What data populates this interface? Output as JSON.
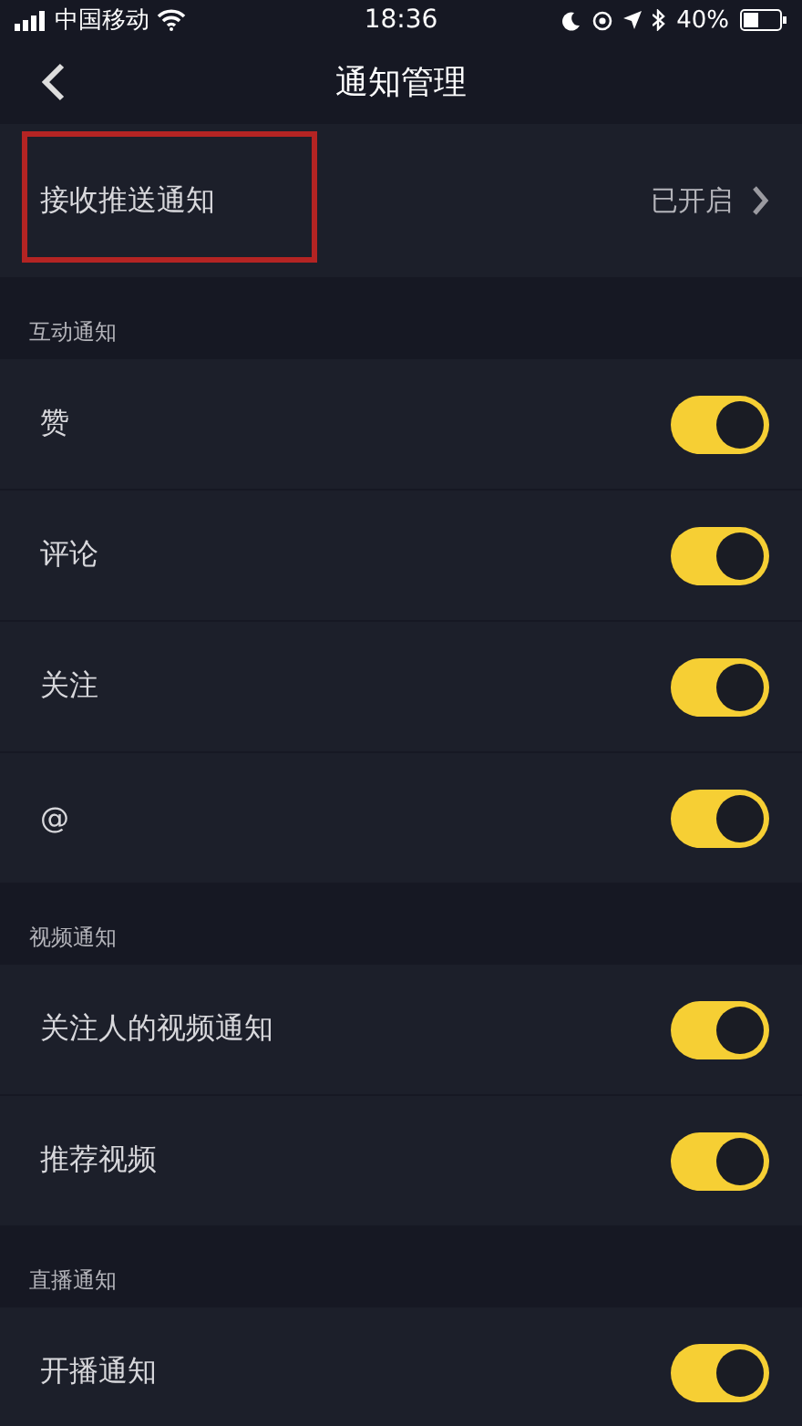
{
  "status_bar": {
    "carrier": "中国移动",
    "time": "18:36",
    "battery": "40%"
  },
  "nav": {
    "title": "通知管理"
  },
  "push_row": {
    "label": "接收推送通知",
    "value": "已开启",
    "highlighted": true
  },
  "sections": [
    {
      "title": "互动通知",
      "items": [
        {
          "label": "赞",
          "on": true
        },
        {
          "label": "评论",
          "on": true
        },
        {
          "label": "关注",
          "on": true
        },
        {
          "label": "@",
          "on": true
        }
      ]
    },
    {
      "title": "视频通知",
      "items": [
        {
          "label": "关注人的视频通知",
          "on": true
        },
        {
          "label": "推荐视频",
          "on": true
        }
      ]
    },
    {
      "title": "直播通知",
      "items": [
        {
          "label": "开播通知",
          "on": true
        }
      ]
    }
  ]
}
